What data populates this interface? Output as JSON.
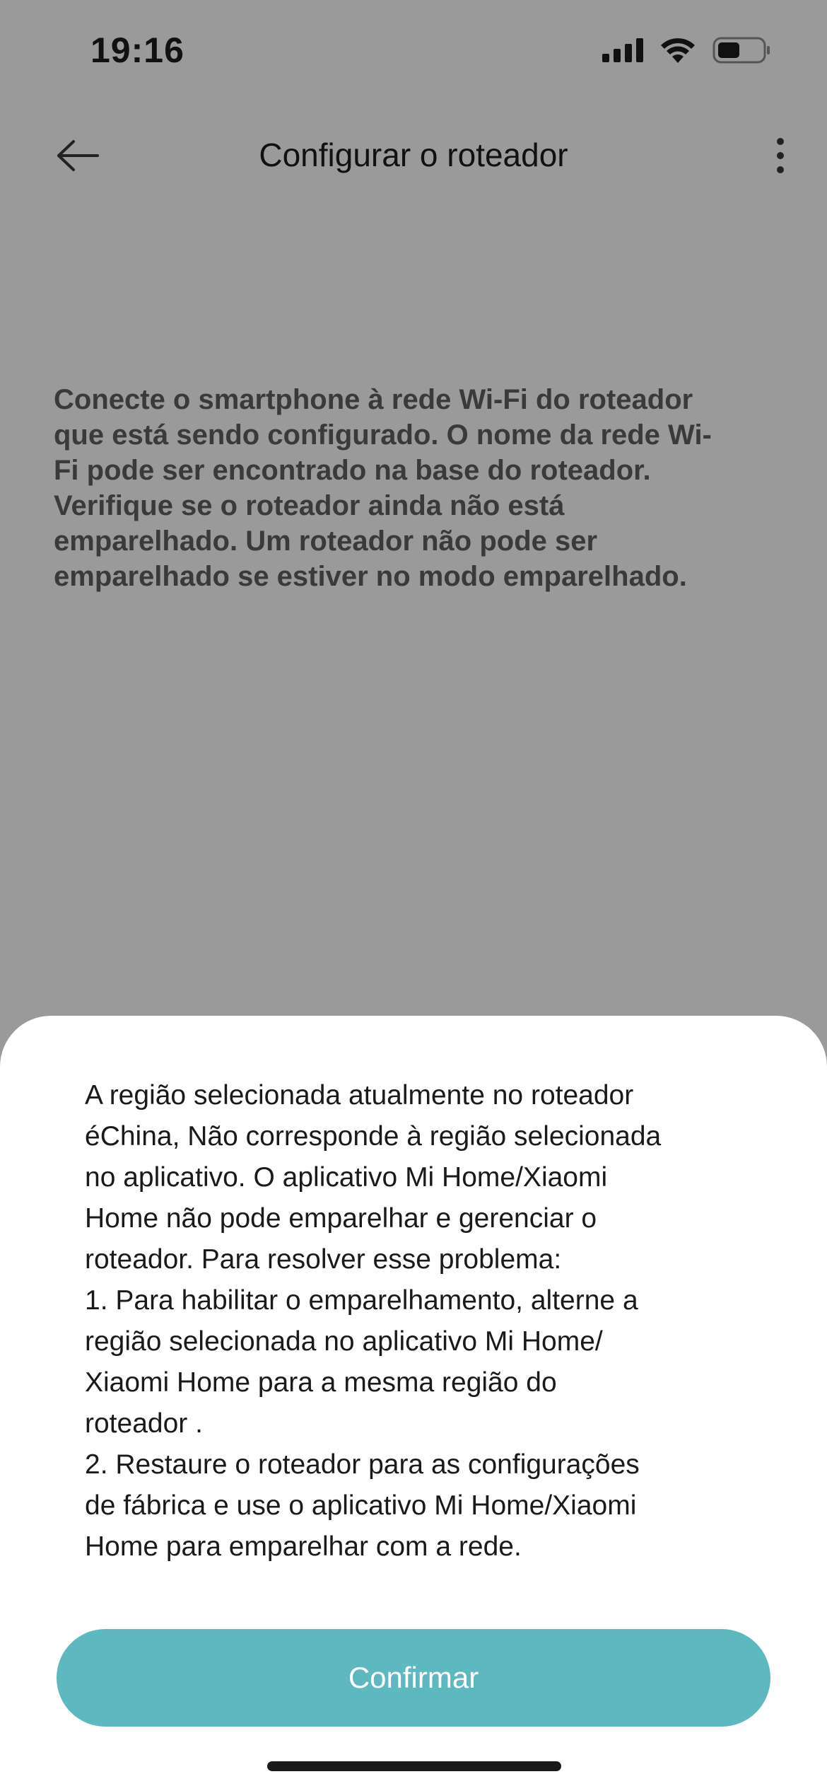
{
  "status_bar": {
    "time": "19:16"
  },
  "header": {
    "title": "Configurar o roteador",
    "back_icon": "arrow-left-icon",
    "more_icon": "more-vertical-icon"
  },
  "instructions": {
    "text": "Conecte o smartphone à rede Wi-Fi do roteador\nque está sendo configurado. O nome da rede Wi-\nFi pode ser encontrado na base do roteador.\n Verifique se o roteador ainda não está\nemparelhado. Um roteador não pode ser\nemparelhado se estiver no modo emparelhado."
  },
  "dialog": {
    "message": "A região selecionada atualmente no roteador\néChina, Não corresponde à região selecionada\nno aplicativo. O aplicativo Mi Home/Xiaomi\nHome não pode emparelhar e gerenciar o\nroteador. Para resolver esse problema:\n1. Para habilitar o emparelhamento, alterne a\nregião selecionada no aplicativo Mi Home/\nXiaomi Home para a mesma região do\nroteador .\n2. Restaure o roteador para as configurações\nde fábrica e use o aplicativo Mi Home/Xiaomi\nHome para emparelhar com a rede.",
    "confirm_label": "Confirmar"
  },
  "colors": {
    "overlay_background": "#9a9a9a",
    "accent": "#5eb8bf",
    "sheet_background": "#ffffff"
  }
}
